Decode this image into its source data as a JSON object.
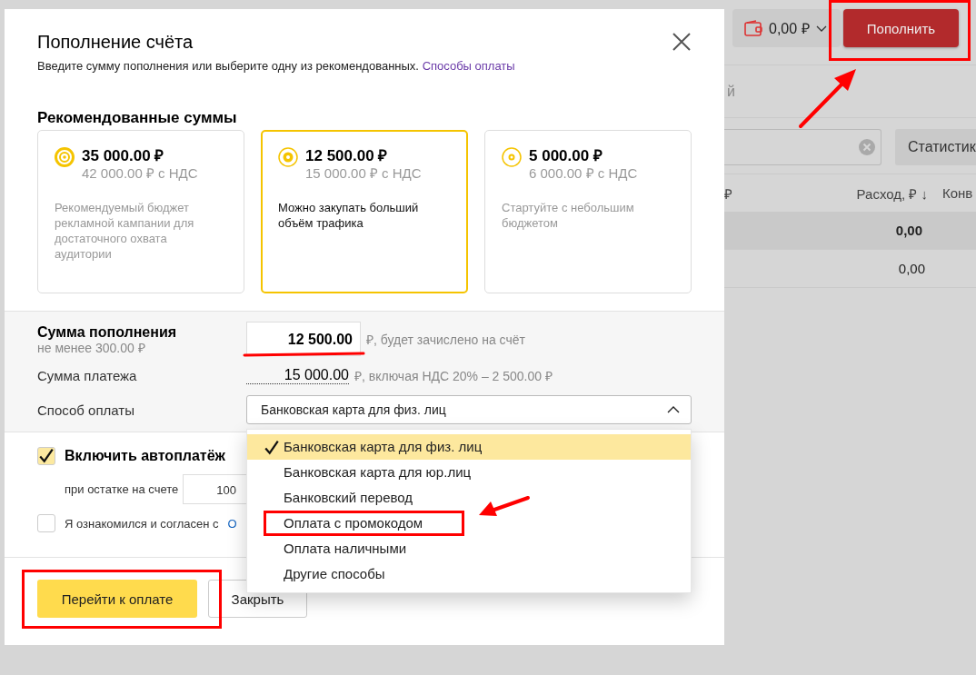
{
  "modal": {
    "title": "Пополнение счёта",
    "subtitle": "Введите сумму пополнения или выберите одну из рекомендованных.",
    "subtitle_link": "Способы оплаты",
    "recommended": {
      "title": "Рекомендованные суммы",
      "cards": [
        {
          "kind": "large",
          "amount": "35 000.00 ₽",
          "with_vat": "42 000.00 ₽ с НДС",
          "description": "Рекомендуемый бюджет рекламной кампании для достаточного охвата аудитории",
          "selected": false
        },
        {
          "kind": "medium",
          "amount": "12 500.00 ₽",
          "with_vat": "15 000.00 ₽ с НДС",
          "description": "Можно закупать больший объём трафика",
          "selected": true
        },
        {
          "kind": "small",
          "amount": "5 000.00 ₽",
          "with_vat": "6 000.00 ₽ с НДС",
          "description": "Стартуйте с небольшим бюджетом",
          "selected": false
        }
      ]
    },
    "amount": {
      "label": "Сумма пополнения",
      "hint": "не менее 300.00 ₽",
      "value": "12 500.00",
      "suffix": "₽, будет зачислено на счёт"
    },
    "payment": {
      "label": "Сумма платежа",
      "value": "15 000.00",
      "suffix": "₽, включая НДС 20% – 2 500.00 ₽"
    },
    "method": {
      "label": "Способ оплаты",
      "value": "Банковская карта для физ. лиц",
      "expanded": true,
      "options": [
        {
          "label": "Банковская карта для физ. лиц",
          "selected": true
        },
        {
          "label": "Банковская карта для юр.лиц",
          "selected": false
        },
        {
          "label": "Банковский перевод",
          "selected": false
        },
        {
          "label": "Оплата с промокодом",
          "selected": false
        },
        {
          "label": "Оплата наличными",
          "selected": false
        },
        {
          "label": "Другие способы",
          "selected": false
        }
      ]
    },
    "autopay": {
      "label": "Включить автоплатёж",
      "checked": true,
      "threshold_label": "при остатке на счете",
      "threshold_value": "100"
    },
    "agreement": {
      "text": "Я ознакомился и согласен с",
      "link": "О",
      "checked": false
    },
    "buttons": {
      "primary": "Перейти к оплате",
      "secondary": "Закрыть"
    }
  },
  "background": {
    "balance": "0,00 ₽",
    "topup_button": "Пополнить",
    "tab_fragment": "й",
    "stats_button": "Статистик",
    "table": {
      "columns": [
        {
          "label": "₽"
        },
        {
          "label": "Расход, ₽",
          "sort": "↓"
        },
        {
          "label": "Конв"
        }
      ],
      "rows": [
        {
          "value": "0,00",
          "total": true
        },
        {
          "value": "0,00",
          "total": false
        }
      ]
    }
  }
}
